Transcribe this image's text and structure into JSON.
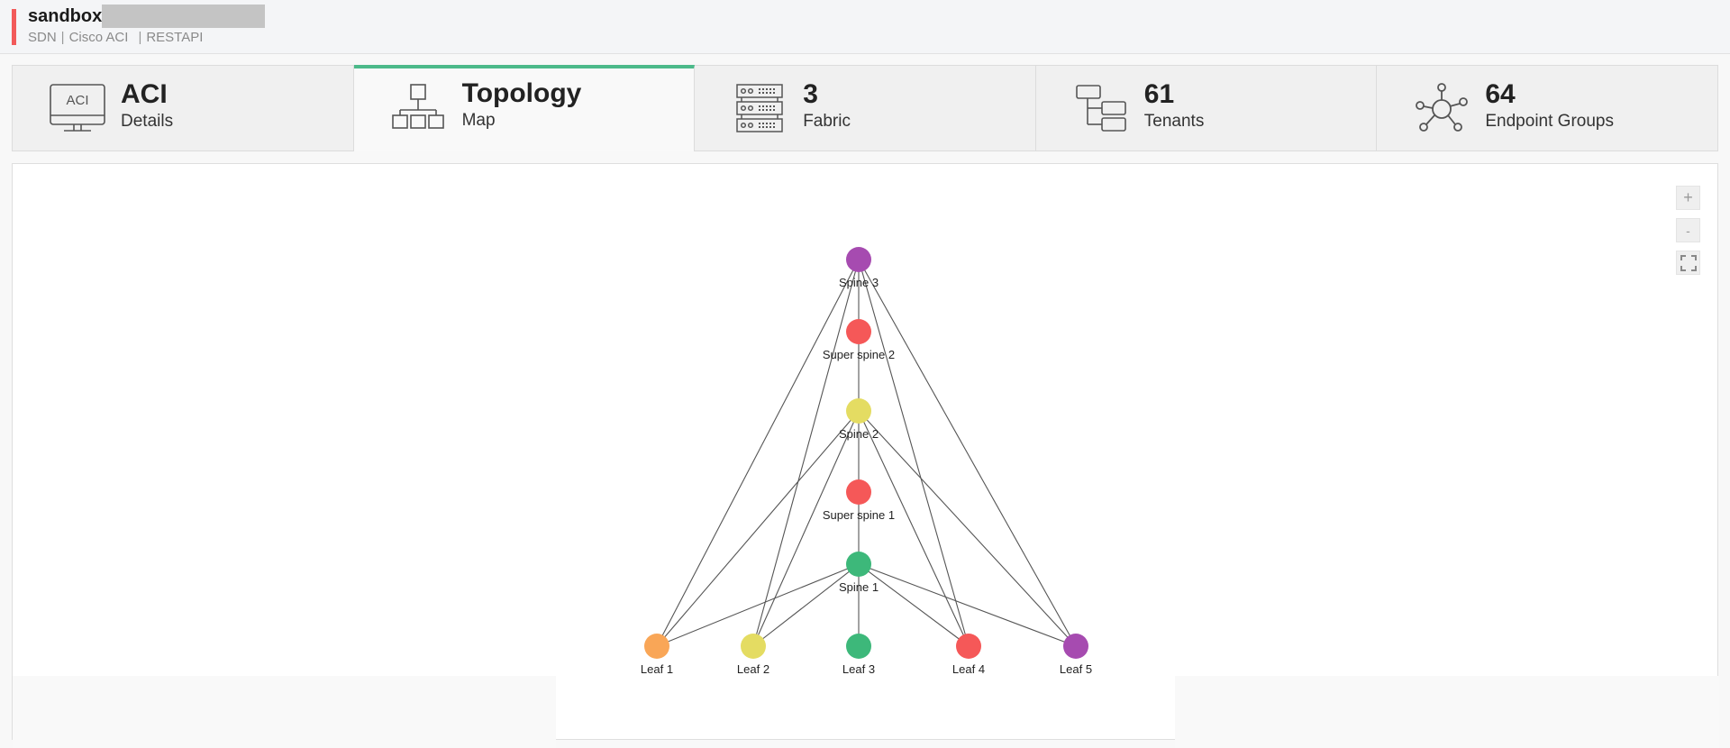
{
  "header": {
    "title": "sandbox",
    "subtitle": [
      "SDN",
      "Cisco ACI",
      "RESTAPI"
    ],
    "accent_color": "#f25a5a"
  },
  "tabs": [
    {
      "id": "details",
      "value": "ACI",
      "label": "Details",
      "icon": "monitor-aci-icon",
      "icon_text": "ACI",
      "active": false
    },
    {
      "id": "topology",
      "value": "Topology",
      "label": "Map",
      "icon": "hierarchy-icon",
      "active": true
    },
    {
      "id": "fabric",
      "value": "3",
      "label": "Fabric",
      "icon": "server-rack-icon",
      "active": false
    },
    {
      "id": "tenants",
      "value": "61",
      "label": "Tenants",
      "icon": "tree-icon",
      "active": false
    },
    {
      "id": "epg",
      "value": "64",
      "label": "Endpoint Groups",
      "icon": "network-hub-icon",
      "active": false
    }
  ],
  "active_tab_color": "#4cba8a",
  "zoom_controls": {
    "zoom_in": "+",
    "zoom_out": "-",
    "fit": "fit-screen-icon"
  },
  "topology": {
    "nodes": [
      {
        "id": "spine3",
        "label": "Spine 3",
        "color": "#a64bb0",
        "row": 0,
        "col": 2
      },
      {
        "id": "superspine2",
        "label": "Super spine 2",
        "color": "#f55858",
        "row": 1,
        "col": 2
      },
      {
        "id": "spine2",
        "label": "Spine 2",
        "color": "#e4dc62",
        "row": 2,
        "col": 2
      },
      {
        "id": "superspine1",
        "label": "Super spine 1",
        "color": "#f55858",
        "row": 3,
        "col": 2
      },
      {
        "id": "spine1",
        "label": "Spine 1",
        "color": "#3db87a",
        "row": 4,
        "col": 2
      },
      {
        "id": "leaf1",
        "label": "Leaf 1",
        "color": "#f9a657",
        "row": 5,
        "col": 0
      },
      {
        "id": "leaf2",
        "label": "Leaf 2",
        "color": "#e4dc62",
        "row": 5,
        "col": 1
      },
      {
        "id": "leaf3",
        "label": "Leaf 3",
        "color": "#3db87a",
        "row": 5,
        "col": 2
      },
      {
        "id": "leaf4",
        "label": "Leaf 4",
        "color": "#f55858",
        "row": 5,
        "col": 3
      },
      {
        "id": "leaf5",
        "label": "Leaf 5",
        "color": "#a64bb0",
        "row": 5,
        "col": 4
      }
    ],
    "edges": [
      [
        "spine3",
        "superspine2"
      ],
      [
        "superspine2",
        "spine2"
      ],
      [
        "spine2",
        "superspine1"
      ],
      [
        "superspine1",
        "spine1"
      ],
      [
        "spine1",
        "leaf3"
      ],
      [
        "spine3",
        "leaf1"
      ],
      [
        "spine3",
        "leaf2"
      ],
      [
        "spine3",
        "leaf4"
      ],
      [
        "spine3",
        "leaf5"
      ],
      [
        "spine2",
        "leaf1"
      ],
      [
        "spine2",
        "leaf2"
      ],
      [
        "spine2",
        "leaf4"
      ],
      [
        "spine2",
        "leaf5"
      ],
      [
        "spine1",
        "leaf1"
      ],
      [
        "spine1",
        "leaf2"
      ],
      [
        "spine1",
        "leaf4"
      ],
      [
        "spine1",
        "leaf5"
      ]
    ]
  }
}
